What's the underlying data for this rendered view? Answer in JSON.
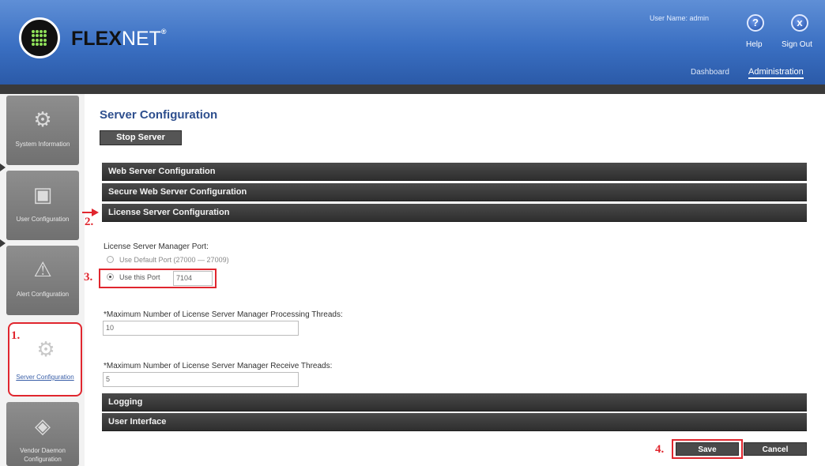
{
  "header": {
    "logo_bold": "FLEX",
    "logo_light": "NET",
    "logo_mark": "®",
    "user_text": "User Name: admin",
    "help_label": "Help",
    "signout_label": "Sign Out",
    "help_glyph": "?",
    "signout_glyph": "x"
  },
  "nav": {
    "dashboard": "Dashboard",
    "administration": "Administration"
  },
  "sidebar": {
    "items": [
      {
        "label": "System Information",
        "icon": "gears-icon"
      },
      {
        "label": "User Configuration",
        "icon": "user-card-icon"
      },
      {
        "label": "Alert Configuration",
        "icon": "alert-icon"
      },
      {
        "label": "Server Configuration",
        "icon": "server-gears-icon"
      },
      {
        "label": "Vendor Daemon Configuration",
        "icon": "vendor-daemon-icon"
      }
    ]
  },
  "main": {
    "title": "Server Configuration",
    "stop_button": "Stop Server",
    "sections": {
      "web": "Web Server Configuration",
      "secure_web": "Secure Web Server Configuration",
      "license": "License Server Configuration",
      "logging": "Logging",
      "ui": "User Interface"
    },
    "port_label": "License Server Manager Port:",
    "default_port_option": "Use Default Port (27000 — 27009)",
    "this_port_option": "Use this Port",
    "port_value": "7104",
    "processing_threads_label": "*Maximum Number of License Server Manager Processing Threads:",
    "processing_threads_value": "10",
    "receive_threads_label": "*Maximum Number of License Server Manager Receive Threads:",
    "receive_threads_value": "5",
    "save_button": "Save",
    "cancel_button": "Cancel"
  },
  "callouts": {
    "one": "1.",
    "two": "2.",
    "three": "3.",
    "four": "4."
  },
  "colors": {
    "header_blue": "#3a6fc2",
    "highlight_red": "#e0262e",
    "title_blue": "#2e4f8e",
    "bar_dark": "#2e2e2e"
  }
}
